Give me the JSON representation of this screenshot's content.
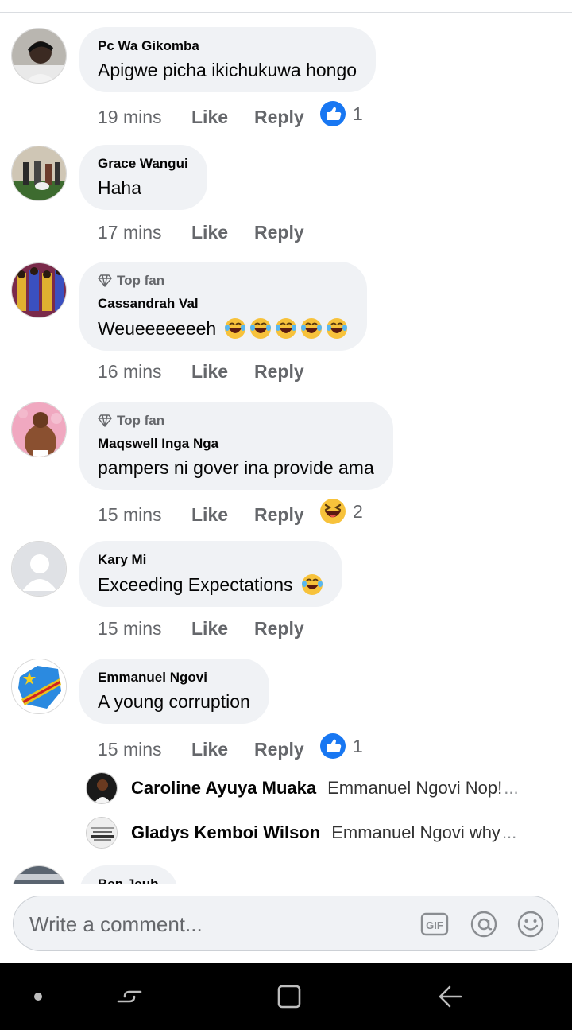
{
  "comments": [
    {
      "author": "Pc Wa Gikomba",
      "text": "Apigwe picha ikichukuwa hongo",
      "time": "19 mins",
      "like": "Like",
      "reply": "Reply",
      "reaction_count": "1",
      "reaction": "like-reaction-icon"
    },
    {
      "author": "Grace Wangui",
      "text": "Haha",
      "time": "17 mins",
      "like": "Like",
      "reply": "Reply"
    },
    {
      "badge": "Top fan",
      "author": "Cassandrah Val",
      "text": "Weueeeeeeeh",
      "time": "16 mins",
      "like": "Like",
      "reply": "Reply"
    },
    {
      "badge": "Top fan",
      "author": "Maqswell Inga Nga",
      "text": "pampers ni gover ina provide ama",
      "time": "15 mins",
      "like": "Like",
      "reply": "Reply",
      "reaction_count": "2",
      "reaction": "haha-reaction-icon"
    },
    {
      "author": "Kary Mi",
      "text": "Exceeding Expectations",
      "time": "15 mins",
      "like": "Like",
      "reply": "Reply"
    },
    {
      "author": "Emmanuel Ngovi",
      "text": "A young corruption",
      "time": "15 mins",
      "like": "Like",
      "reply": "Reply",
      "reaction_count": "1",
      "reaction": "like-reaction-icon"
    },
    {
      "author": "Ben Jeub"
    }
  ],
  "replies": [
    {
      "author": "Caroline Ayuya Muaka",
      "text": "Emmanuel Ngovi  Nop!",
      "ellipsis": "..."
    },
    {
      "author": "Gladys Kemboi Wilson",
      "text": "Emmanuel Ngovi why",
      "ellipsis": "..."
    }
  ],
  "composer": {
    "placeholder": "Write a comment...",
    "icons": [
      "gif-icon",
      "mention-icon",
      "emoji-icon"
    ]
  },
  "navbar": {
    "icons": [
      "dot-icon",
      "recent-apps-icon",
      "home-icon",
      "back-icon"
    ]
  },
  "colors": {
    "bubble": "#f0f2f5",
    "meta": "#65676b",
    "like_blue": "#1877f2",
    "navbar": "#000000"
  }
}
